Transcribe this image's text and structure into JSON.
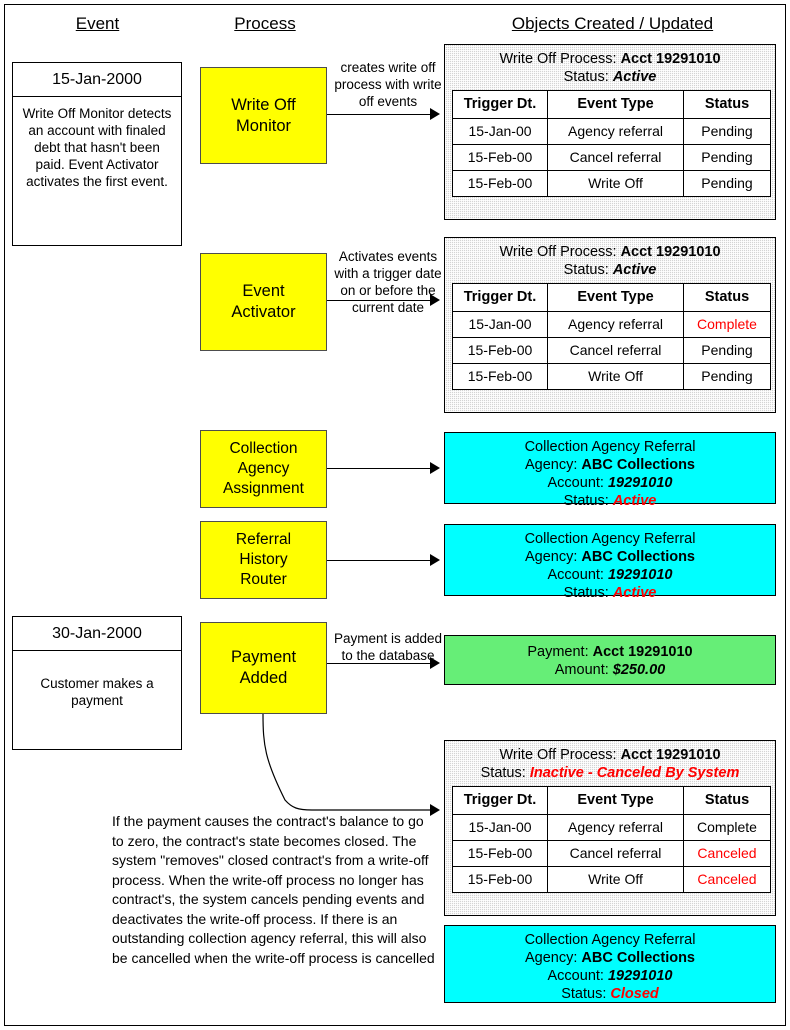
{
  "headers": {
    "event": "Event",
    "process": "Process",
    "objects": "Objects Created / Updated"
  },
  "events": [
    {
      "date": "15-Jan-2000",
      "description": "Write Off Monitor detects an account with finaled debt that hasn't been paid. Event Activator activates the first event."
    },
    {
      "date": "30-Jan-2000",
      "description": "Customer makes a payment"
    }
  ],
  "processes": [
    {
      "label": "Write Off\nMonitor"
    },
    {
      "label": "Event\nActivator"
    },
    {
      "label": "Collection\nAgency\nAssignment"
    },
    {
      "label": "Referral\nHistory\nRouter"
    },
    {
      "label": "Payment\nAdded"
    }
  ],
  "connectors": [
    {
      "label": "creates write off process with write off events"
    },
    {
      "label": "Activates events with a trigger date on or before the current date"
    },
    {
      "label": "Payment is added to the database"
    }
  ],
  "table_columns": [
    "Trigger Dt.",
    "Event Type",
    "Status"
  ],
  "panels": [
    {
      "kind": "process-table",
      "title_prefix": "Write Off Process: ",
      "title_value": "Acct 19291010",
      "status_label": "Status: ",
      "status_value": "Active",
      "status_color": "#000000",
      "rows": [
        {
          "date": "15-Jan-00",
          "event": "Agency referral",
          "status": "Pending",
          "status_color": "#000000"
        },
        {
          "date": "15-Feb-00",
          "event": "Cancel referral",
          "status": "Pending",
          "status_color": "#000000"
        },
        {
          "date": "15-Feb-00",
          "event": "Write Off",
          "status": "Pending",
          "status_color": "#000000"
        }
      ]
    },
    {
      "kind": "process-table",
      "title_prefix": "Write Off Process: ",
      "title_value": "Acct 19291010",
      "status_label": "Status: ",
      "status_value": "Active",
      "status_color": "#000000",
      "rows": [
        {
          "date": "15-Jan-00",
          "event": "Agency referral",
          "status": "Complete",
          "status_color": "#ff0000"
        },
        {
          "date": "15-Feb-00",
          "event": "Cancel referral",
          "status": "Pending",
          "status_color": "#000000"
        },
        {
          "date": "15-Feb-00",
          "event": "Write Off",
          "status": "Pending",
          "status_color": "#000000"
        }
      ]
    },
    {
      "kind": "referral",
      "line1": "Collection Agency Referral",
      "line2_label": "Agency: ",
      "line2_value": "ABC Collections",
      "line3_label": "Account: ",
      "line3_value": "19291010",
      "line4_label": "Status: ",
      "line4_value": "Active",
      "line4_color": "#ff0000"
    },
    {
      "kind": "referral",
      "line1": "Collection Agency Referral",
      "line2_label": "Agency: ",
      "line2_value": "ABC Collections",
      "line3_label": "Account: ",
      "line3_value": "19291010",
      "line4_label": "Status: ",
      "line4_value": "Active",
      "line4_color": "#ff0000"
    },
    {
      "kind": "payment",
      "line1_label": "Payment: ",
      "line1_value": "Acct 19291010",
      "line2_label": "Amount: ",
      "line2_value": "$250.00"
    },
    {
      "kind": "process-table",
      "title_prefix": "Write Off Process: ",
      "title_value": "Acct 19291010",
      "status_label": "Status: ",
      "status_value": "Inactive - Canceled By System",
      "status_color": "#ff0000",
      "rows": [
        {
          "date": "15-Jan-00",
          "event": "Agency referral",
          "status": "Complete",
          "status_color": "#000000"
        },
        {
          "date": "15-Feb-00",
          "event": "Cancel referral",
          "status": "Canceled",
          "status_color": "#ff0000"
        },
        {
          "date": "15-Feb-00",
          "event": "Write Off",
          "status": "Canceled",
          "status_color": "#ff0000"
        }
      ]
    },
    {
      "kind": "referral",
      "line1": "Collection Agency Referral",
      "line2_label": "Agency: ",
      "line2_value": "ABC Collections",
      "line3_label": "Account: ",
      "line3_value": "19291010",
      "line4_label": "Status: ",
      "line4_value": "Closed",
      "line4_color": "#ff0000"
    }
  ],
  "note": "If the payment causes the contract's balance to go to zero,  the contract's state becomes closed.  The system \"removes\" closed contract's from a write-off process.  When the write-off process no longer has contract's, the system cancels pending events and deactivates the write-off process.  If there is an outstanding collection agency referral, this will also be cancelled when the write-off process is cancelled",
  "colors": {
    "process_fill": "#ffff00",
    "referral_fill": "#00ffff",
    "payment_fill": "#66ee77",
    "panel_fill": "#d4d4d4",
    "alert": "#ff0000"
  }
}
